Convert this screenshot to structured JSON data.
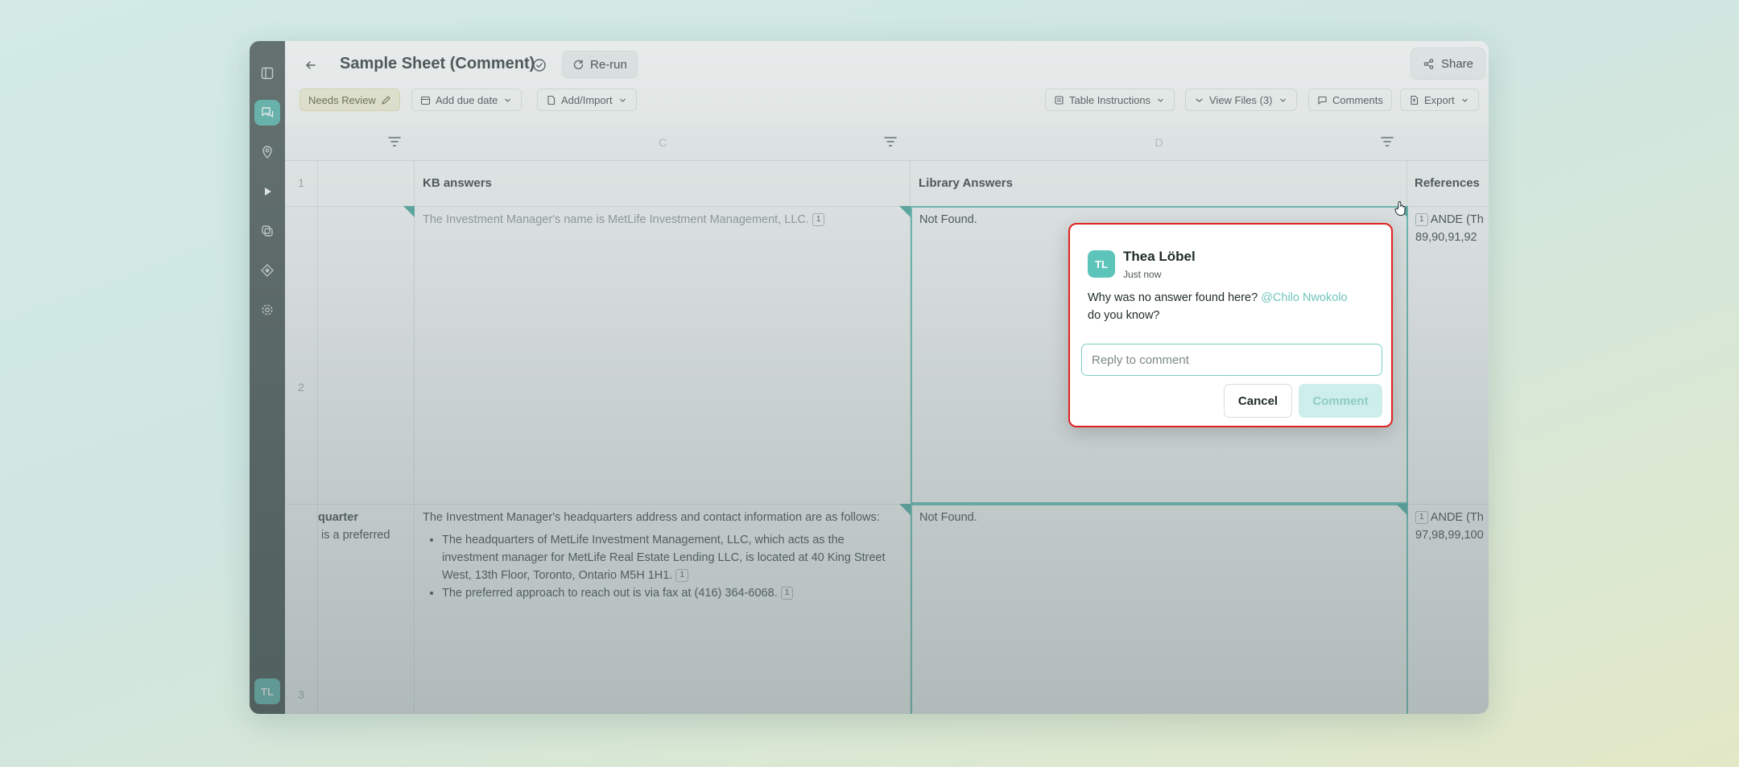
{
  "header": {
    "title": "Sample Sheet (Comment)",
    "rerun_label": "Re-run",
    "share_label": "Share"
  },
  "toolbar": {
    "needs_review_label": "Needs Review",
    "due_date_label": "Add due date",
    "add_import_label": "Add/Import",
    "table_instructions_label": "Table Instructions",
    "view_files_label": "View Files (3)",
    "comments_label": "Comments",
    "export_label": "Export"
  },
  "sidebar": {
    "icons": [
      "panel-toggle-icon",
      "chat-icon",
      "location-pin-icon",
      "play-icon",
      "copy-icon",
      "layers-icon",
      "settings-icon"
    ],
    "active_index": 1,
    "avatar_initials": "TL"
  },
  "grid": {
    "column_letters": [
      "C",
      "D"
    ],
    "headers": {
      "kb": "KB answers",
      "library": "Library Answers",
      "references": "References"
    },
    "row_numbers": [
      "1",
      "2",
      "3"
    ],
    "row2": {
      "question_fragment": "",
      "kb_answer": "The Investment Manager's name is MetLife Investment Management, LLC.",
      "kb_cite": "1",
      "library_answer": "Not Found.",
      "ref_cite": "1",
      "ref_text": "ANDE (Th",
      "ref_pages": "89,90,91,92"
    },
    "row3": {
      "question_fragment_1": "quarter",
      "question_fragment_2": "is a preferred",
      "kb_intro": "The Investment Manager's headquarters address and contact information are as follows:",
      "kb_bullet_1": "The headquarters of MetLife Investment Management, LLC, which acts as the investment manager for MetLife Real Estate Lending LLC, is located at 40 King Street West, 13th Floor, Toronto, Ontario M5H 1H1.",
      "kb_bullet_1_cite": "1",
      "kb_bullet_2": "The preferred approach to reach out is via fax at (416) 364-6068.",
      "kb_bullet_2_cite": "1",
      "library_answer": "Not Found.",
      "ref_cite": "1",
      "ref_text": "ANDE (Th",
      "ref_pages": "97,98,99,100"
    }
  },
  "comment_popup": {
    "author_initials": "TL",
    "author_name": "Thea Löbel",
    "timestamp": "Just now",
    "message_prefix": "Why was no answer found here?",
    "mention": "@Chilo Nwokolo",
    "message_suffix": "do you know?",
    "reply_placeholder": "Reply to comment",
    "cancel_label": "Cancel",
    "comment_label": "Comment"
  },
  "colors": {
    "accent": "#4fb3aa",
    "highlight_border": "#e02020",
    "mention": "#6fc6bc"
  }
}
